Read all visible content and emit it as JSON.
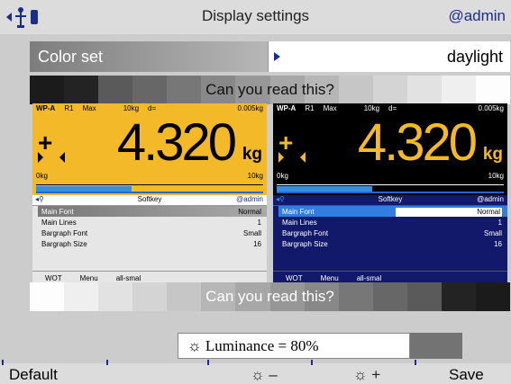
{
  "header": {
    "title": "Display settings",
    "user": "@admin"
  },
  "color_set": {
    "label": "Color set",
    "value": "daylight"
  },
  "readability_prompt_top": "Can you read this?",
  "readability_prompt_bottom": "Can you read this?",
  "preview_panels": [
    {
      "theme": "daylight",
      "header": {
        "model": "WP-A",
        "range": "R1",
        "max_label": "Max",
        "max_value": "10kg",
        "d_label": "d=",
        "d_value": "0.005kg"
      },
      "weight": "4.320",
      "unit": "kg",
      "scale_min": "0kg",
      "scale_max": "10kg",
      "softkey_title": "Softkey",
      "softkey_user": "@admin",
      "menu_items": [
        {
          "name": "Main Font",
          "value": "Normal"
        },
        {
          "name": "Main Lines",
          "value": "1"
        },
        {
          "name": "Bargraph Font",
          "value": "Small"
        },
        {
          "name": "Bargraph Size",
          "value": "16"
        }
      ],
      "softkeys": [
        "WOT",
        "Menu",
        "all-smal"
      ]
    },
    {
      "theme": "night",
      "header": {
        "model": "WP-A",
        "range": "R1",
        "max_label": "Max",
        "max_value": "10kg",
        "d_label": "d=",
        "d_value": "0.005kg"
      },
      "weight": "4.320",
      "unit": "kg",
      "scale_min": "0kg",
      "scale_max": "10kg",
      "softkey_title": "Softkey",
      "softkey_user": "@admin",
      "menu_items": [
        {
          "name": "Main Font",
          "value": "Normal"
        },
        {
          "name": "Main Lines",
          "value": "1"
        },
        {
          "name": "Bargraph Font",
          "value": "Small"
        },
        {
          "name": "Bargraph Size",
          "value": "16"
        }
      ],
      "softkeys": [
        "WOT",
        "Menu",
        "all-smal"
      ]
    }
  ],
  "luminance": {
    "icon": "sun-icon",
    "label": "Luminance = 80%"
  },
  "footer": {
    "default": "Default",
    "minus": "☼ –",
    "plus": "☼ +",
    "save": "Save"
  },
  "colors": {
    "accent_blue": "#1d2d8c",
    "yellow_panel": "#f3b928",
    "bar_blue": "#3a8de0"
  }
}
